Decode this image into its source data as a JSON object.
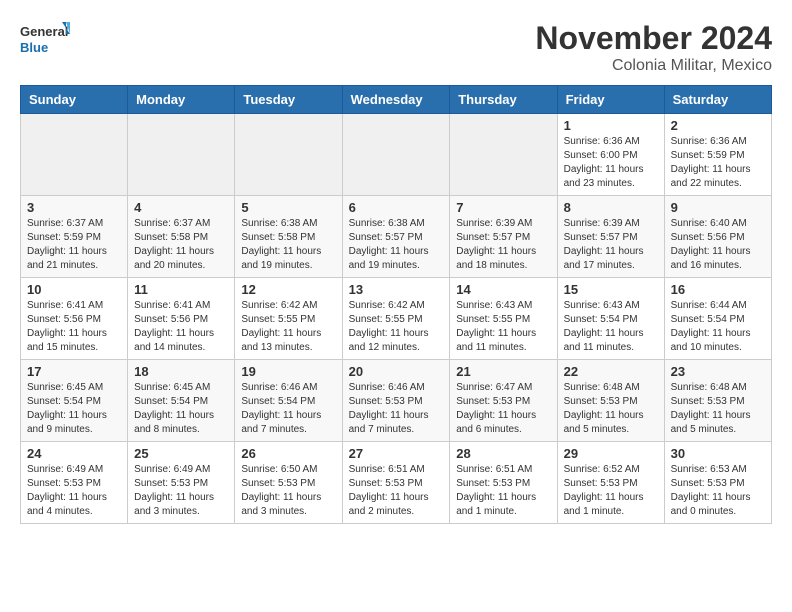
{
  "header": {
    "logo_general": "General",
    "logo_blue": "Blue",
    "title": "November 2024",
    "subtitle": "Colonia Militar, Mexico"
  },
  "weekdays": [
    "Sunday",
    "Monday",
    "Tuesday",
    "Wednesday",
    "Thursday",
    "Friday",
    "Saturday"
  ],
  "weeks": [
    [
      {
        "day": "",
        "info": ""
      },
      {
        "day": "",
        "info": ""
      },
      {
        "day": "",
        "info": ""
      },
      {
        "day": "",
        "info": ""
      },
      {
        "day": "",
        "info": ""
      },
      {
        "day": "1",
        "info": "Sunrise: 6:36 AM\nSunset: 6:00 PM\nDaylight: 11 hours and 23 minutes."
      },
      {
        "day": "2",
        "info": "Sunrise: 6:36 AM\nSunset: 5:59 PM\nDaylight: 11 hours and 22 minutes."
      }
    ],
    [
      {
        "day": "3",
        "info": "Sunrise: 6:37 AM\nSunset: 5:59 PM\nDaylight: 11 hours and 21 minutes."
      },
      {
        "day": "4",
        "info": "Sunrise: 6:37 AM\nSunset: 5:58 PM\nDaylight: 11 hours and 20 minutes."
      },
      {
        "day": "5",
        "info": "Sunrise: 6:38 AM\nSunset: 5:58 PM\nDaylight: 11 hours and 19 minutes."
      },
      {
        "day": "6",
        "info": "Sunrise: 6:38 AM\nSunset: 5:57 PM\nDaylight: 11 hours and 19 minutes."
      },
      {
        "day": "7",
        "info": "Sunrise: 6:39 AM\nSunset: 5:57 PM\nDaylight: 11 hours and 18 minutes."
      },
      {
        "day": "8",
        "info": "Sunrise: 6:39 AM\nSunset: 5:57 PM\nDaylight: 11 hours and 17 minutes."
      },
      {
        "day": "9",
        "info": "Sunrise: 6:40 AM\nSunset: 5:56 PM\nDaylight: 11 hours and 16 minutes."
      }
    ],
    [
      {
        "day": "10",
        "info": "Sunrise: 6:41 AM\nSunset: 5:56 PM\nDaylight: 11 hours and 15 minutes."
      },
      {
        "day": "11",
        "info": "Sunrise: 6:41 AM\nSunset: 5:56 PM\nDaylight: 11 hours and 14 minutes."
      },
      {
        "day": "12",
        "info": "Sunrise: 6:42 AM\nSunset: 5:55 PM\nDaylight: 11 hours and 13 minutes."
      },
      {
        "day": "13",
        "info": "Sunrise: 6:42 AM\nSunset: 5:55 PM\nDaylight: 11 hours and 12 minutes."
      },
      {
        "day": "14",
        "info": "Sunrise: 6:43 AM\nSunset: 5:55 PM\nDaylight: 11 hours and 11 minutes."
      },
      {
        "day": "15",
        "info": "Sunrise: 6:43 AM\nSunset: 5:54 PM\nDaylight: 11 hours and 11 minutes."
      },
      {
        "day": "16",
        "info": "Sunrise: 6:44 AM\nSunset: 5:54 PM\nDaylight: 11 hours and 10 minutes."
      }
    ],
    [
      {
        "day": "17",
        "info": "Sunrise: 6:45 AM\nSunset: 5:54 PM\nDaylight: 11 hours and 9 minutes."
      },
      {
        "day": "18",
        "info": "Sunrise: 6:45 AM\nSunset: 5:54 PM\nDaylight: 11 hours and 8 minutes."
      },
      {
        "day": "19",
        "info": "Sunrise: 6:46 AM\nSunset: 5:54 PM\nDaylight: 11 hours and 7 minutes."
      },
      {
        "day": "20",
        "info": "Sunrise: 6:46 AM\nSunset: 5:53 PM\nDaylight: 11 hours and 7 minutes."
      },
      {
        "day": "21",
        "info": "Sunrise: 6:47 AM\nSunset: 5:53 PM\nDaylight: 11 hours and 6 minutes."
      },
      {
        "day": "22",
        "info": "Sunrise: 6:48 AM\nSunset: 5:53 PM\nDaylight: 11 hours and 5 minutes."
      },
      {
        "day": "23",
        "info": "Sunrise: 6:48 AM\nSunset: 5:53 PM\nDaylight: 11 hours and 5 minutes."
      }
    ],
    [
      {
        "day": "24",
        "info": "Sunrise: 6:49 AM\nSunset: 5:53 PM\nDaylight: 11 hours and 4 minutes."
      },
      {
        "day": "25",
        "info": "Sunrise: 6:49 AM\nSunset: 5:53 PM\nDaylight: 11 hours and 3 minutes."
      },
      {
        "day": "26",
        "info": "Sunrise: 6:50 AM\nSunset: 5:53 PM\nDaylight: 11 hours and 3 minutes."
      },
      {
        "day": "27",
        "info": "Sunrise: 6:51 AM\nSunset: 5:53 PM\nDaylight: 11 hours and 2 minutes."
      },
      {
        "day": "28",
        "info": "Sunrise: 6:51 AM\nSunset: 5:53 PM\nDaylight: 11 hours and 1 minute."
      },
      {
        "day": "29",
        "info": "Sunrise: 6:52 AM\nSunset: 5:53 PM\nDaylight: 11 hours and 1 minute."
      },
      {
        "day": "30",
        "info": "Sunrise: 6:53 AM\nSunset: 5:53 PM\nDaylight: 11 hours and 0 minutes."
      }
    ]
  ]
}
